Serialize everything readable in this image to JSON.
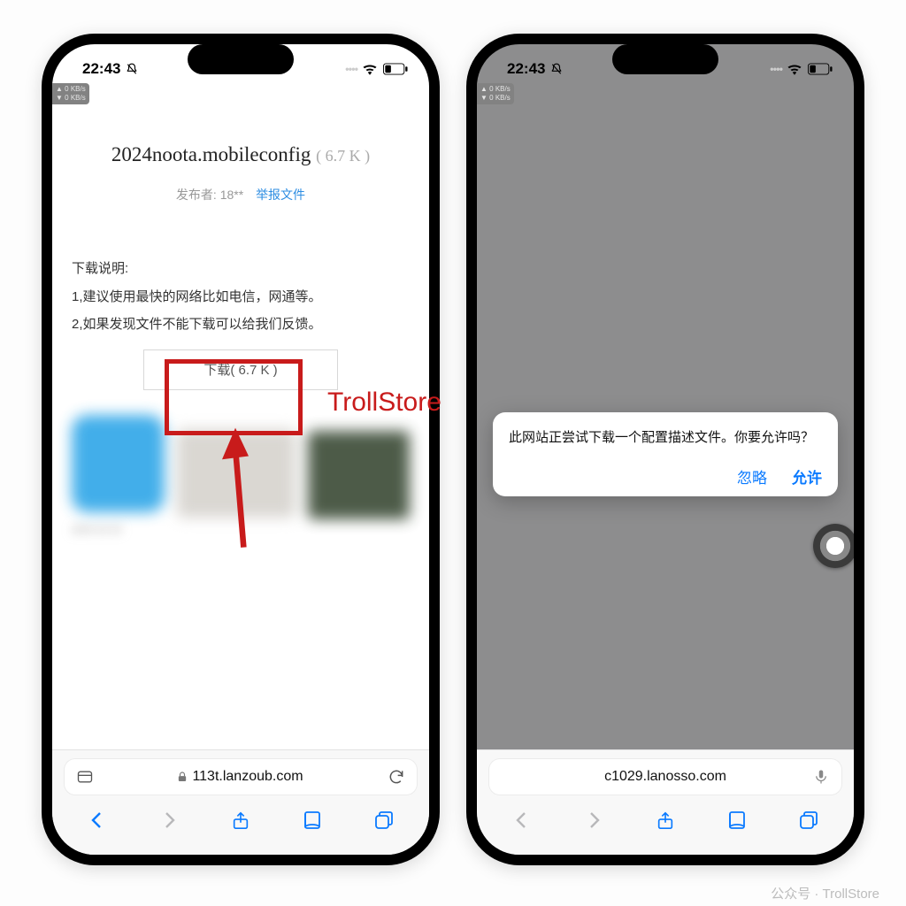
{
  "status": {
    "time": "22:43",
    "net_badge_up": "▲ 0 KB/s",
    "net_badge_down": "▼ 0 KB/s"
  },
  "phone1": {
    "file_name": "2024noota.mobileconfig",
    "file_size_hdr": "( 6.7 K )",
    "publisher_label": "发布者: 18**",
    "report_link": "举报文件",
    "desc_title": "下载说明:",
    "desc_line1": "1,建议使用最快的网络比如电信，网通等。",
    "desc_line2": "2,如果发现文件不能下载可以给我们反馈。",
    "download_btn": "下载( 6.7 K )",
    "url": "113t.lanzoub.com"
  },
  "phone2": {
    "alert_msg": "此网站正尝试下载一个配置描述文件。你要允许吗？",
    "ignore": "忽略",
    "allow": "允许",
    "url": "c1029.lanosso.com"
  },
  "annotation": {
    "label": "TrollStore"
  },
  "watermark": "公众号 · TrollStore"
}
